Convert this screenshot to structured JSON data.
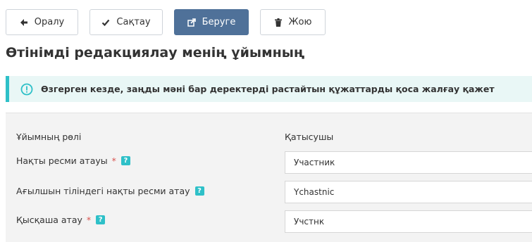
{
  "toolbar": {
    "back_label": "Оралу",
    "save_label": "Сақтау",
    "submit_label": "Беруге",
    "delete_label": "Жою"
  },
  "page": {
    "title": "Өтінімді редакциялау менің ұйымның"
  },
  "alert": {
    "text": "Өзгерген кезде, заңды мәні бар деректерді растайтын құжаттарды қоса жалғау қажет"
  },
  "form": {
    "role": {
      "label": "Ұйымның рөлі",
      "value": "Қатысушы"
    },
    "official_name": {
      "label": "Нақты ресми атауы",
      "required_mark": "*",
      "help": "?",
      "value": "Участник"
    },
    "english_name": {
      "label": "Ағылшын тіліндегі нақты ресми атау",
      "help": "?",
      "value": "Ychastnic"
    },
    "short_name": {
      "label": "Қысқаша атау",
      "required_mark": "*",
      "help": "?",
      "value": "Учстнк"
    }
  },
  "colors": {
    "primary": "#4f7199",
    "info_accent": "#2ec0c8",
    "required": "#d9534f"
  },
  "icons": {
    "back": "arrow-left-icon",
    "save": "check-icon",
    "submit": "share-icon",
    "delete": "trash-icon",
    "alert": "exclamation-circle-icon",
    "help": "question-icon"
  }
}
